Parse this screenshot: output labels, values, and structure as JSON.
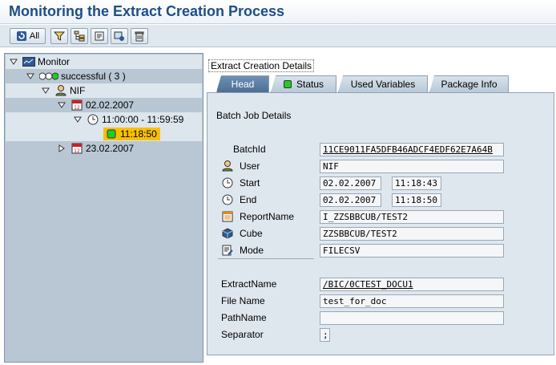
{
  "title": "Monitoring the Extract Creation Process",
  "toolbar": {
    "all_label": "All",
    "icons": [
      "refresh-icon",
      "filter-icon",
      "tree-icon",
      "scroll-icon",
      "process-icon",
      "trash-icon"
    ]
  },
  "tree": {
    "root": "Monitor",
    "status": "successful ( 3 )",
    "user": "NIF",
    "date1": "02.02.2007",
    "time_range": "11:00:00 - 11:59:59",
    "job": "11:18:50",
    "date2": "23.02.2007"
  },
  "details": {
    "header": "Extract Creation Details",
    "tabs": [
      "Head",
      "Status",
      "Used Variables",
      "Package Info"
    ],
    "section_title": "Batch Job Details",
    "labels": {
      "batchid": "BatchId",
      "user": "User",
      "start": "Start",
      "end": "End",
      "reportname": "ReportName",
      "cube": "Cube",
      "mode": "Mode",
      "extractname": "ExtractName",
      "filename": "File Name",
      "pathname": "PathName",
      "separator": "Separator"
    },
    "values": {
      "batchid": "11CE9011FA5DFB46ADCF4EDF62E7A64B",
      "user": "NIF",
      "start_date": "02.02.2007",
      "start_time": "11:18:43",
      "end_date": "02.02.2007",
      "end_time": "11:18:50",
      "reportname": "I_ZZSBBCUB/TEST2",
      "cube": "ZZSBBCUB/TEST2",
      "mode": "FILECSV",
      "extractname": "/BIC/0CTEST_DOCU1",
      "filename": "test_for_doc",
      "pathname": "",
      "separator": ";"
    }
  },
  "colors": {
    "title": "#1d4e88",
    "tree_bg": "#b8c7d3",
    "selection": "#f7c000",
    "active_tab": "#4c6f94",
    "status_green": "#22cc22"
  }
}
